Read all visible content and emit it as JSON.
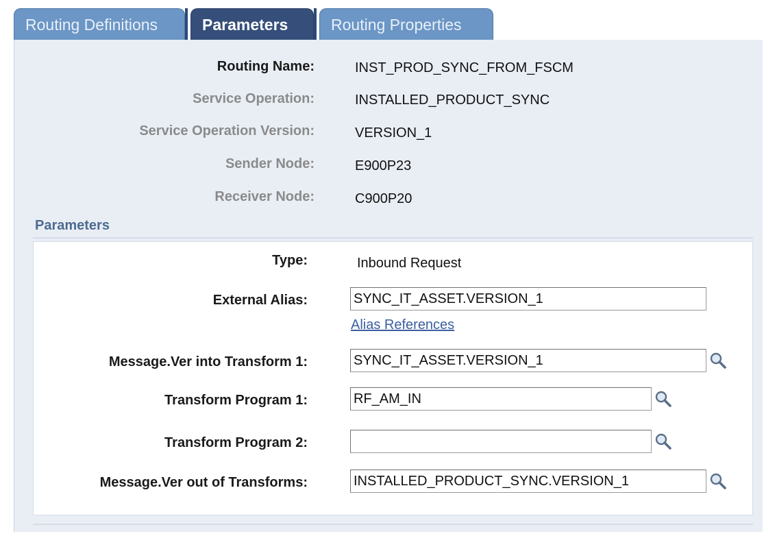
{
  "tabs": [
    {
      "label": "Routing Definitions"
    },
    {
      "label": "Parameters"
    },
    {
      "label": "Routing Properties"
    }
  ],
  "header": {
    "routing_name_label": "Routing Name:",
    "routing_name": "INST_PROD_SYNC_FROM_FSCM",
    "service_operation_label": "Service Operation:",
    "service_operation": "INSTALLED_PRODUCT_SYNC",
    "service_operation_version_label": "Service Operation Version:",
    "service_operation_version": "VERSION_1",
    "sender_node_label": "Sender Node:",
    "sender_node": "E900P23",
    "receiver_node_label": "Receiver Node:",
    "receiver_node": "C900P20"
  },
  "parameters": {
    "section_title": "Parameters",
    "type_label": "Type:",
    "type_value": "Inbound Request",
    "external_alias_label": "External Alias:",
    "external_alias": "SYNC_IT_ASSET.VERSION_1",
    "alias_references_link": "Alias References",
    "msg_into_transform_label": "Message.Ver into Transform 1:",
    "msg_into_transform": "SYNC_IT_ASSET.VERSION_1",
    "transform_program_1_label": "Transform Program 1:",
    "transform_program_1": "RF_AM_IN",
    "transform_program_2_label": "Transform Program 2:",
    "transform_program_2": "",
    "msg_out_of_transforms_label": "Message.Ver out of Transforms:",
    "msg_out_of_transforms": "INSTALLED_PRODUCT_SYNC.VERSION_1"
  },
  "icons": {
    "lookup": "magnifier-lookup-icon"
  },
  "colors": {
    "active_tab": "#354f7a",
    "inactive_tab": "#6b96c6",
    "panel": "#e9eef5",
    "link": "#3a5fa0"
  }
}
